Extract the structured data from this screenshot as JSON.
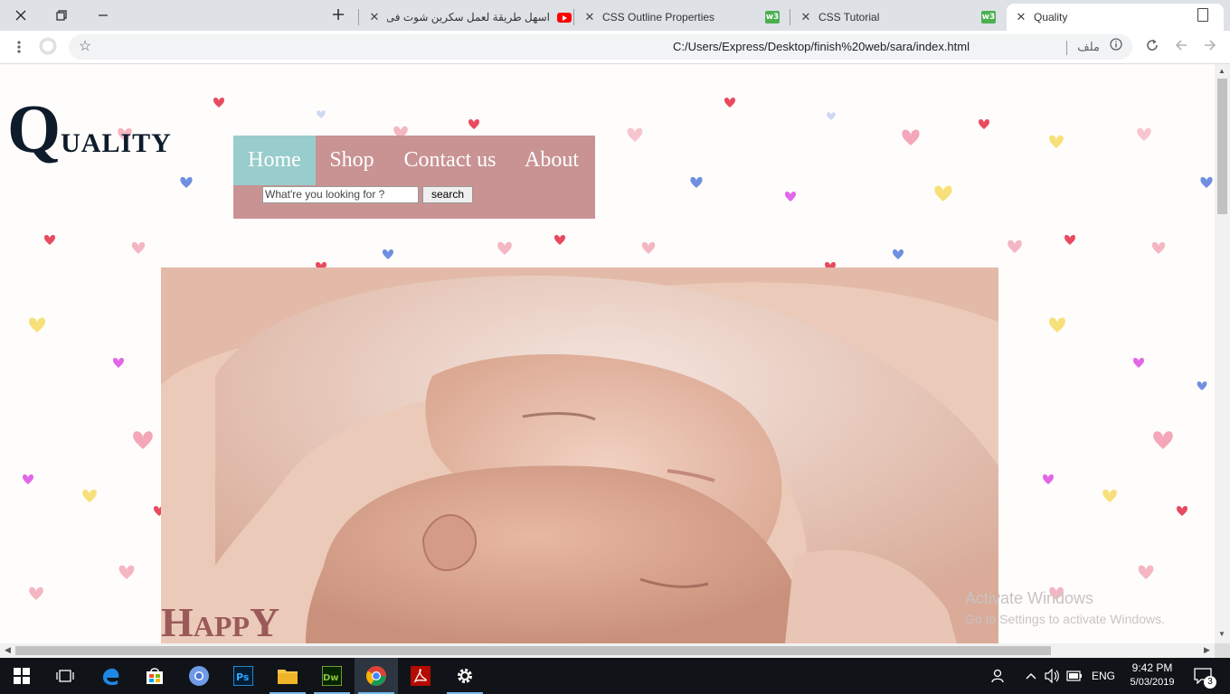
{
  "browser": {
    "tabs": [
      {
        "title": "اسهل طريقة لعمل سكرين شوت فى",
        "favicon": "youtube-icon"
      },
      {
        "title": "CSS Outline Properties",
        "favicon": "w3schools-icon"
      },
      {
        "title": "CSS Tutorial",
        "favicon": "w3schools-icon"
      },
      {
        "title": "Quality",
        "favicon": "document-icon"
      }
    ],
    "w3_label": "w3",
    "url": "C:/Users/Express/Desktop/finish%20web/sara/index.html",
    "url_prefix": "ملف"
  },
  "page": {
    "logo": {
      "initial": "Q",
      "rest": "UALITY"
    },
    "nav": {
      "items": [
        {
          "label": "Home",
          "active": true
        },
        {
          "label": "Shop"
        },
        {
          "label": "Contact us"
        },
        {
          "label": "About"
        }
      ]
    },
    "search": {
      "placeholder": "What're you looking for ?",
      "button_label": "search"
    },
    "hero": {
      "cap_h": "H",
      "small": "APP",
      "cap_y": "Y"
    },
    "nav_colors": {
      "bar": "#c99393",
      "active": "#99cccc"
    }
  },
  "watermark": {
    "line1": "Activate Windows",
    "line2": "Go to Settings to activate Windows."
  },
  "taskbar": {
    "language": "ENG",
    "time": "9:42 PM",
    "date": "5/03/2019",
    "notification_count": "3"
  }
}
